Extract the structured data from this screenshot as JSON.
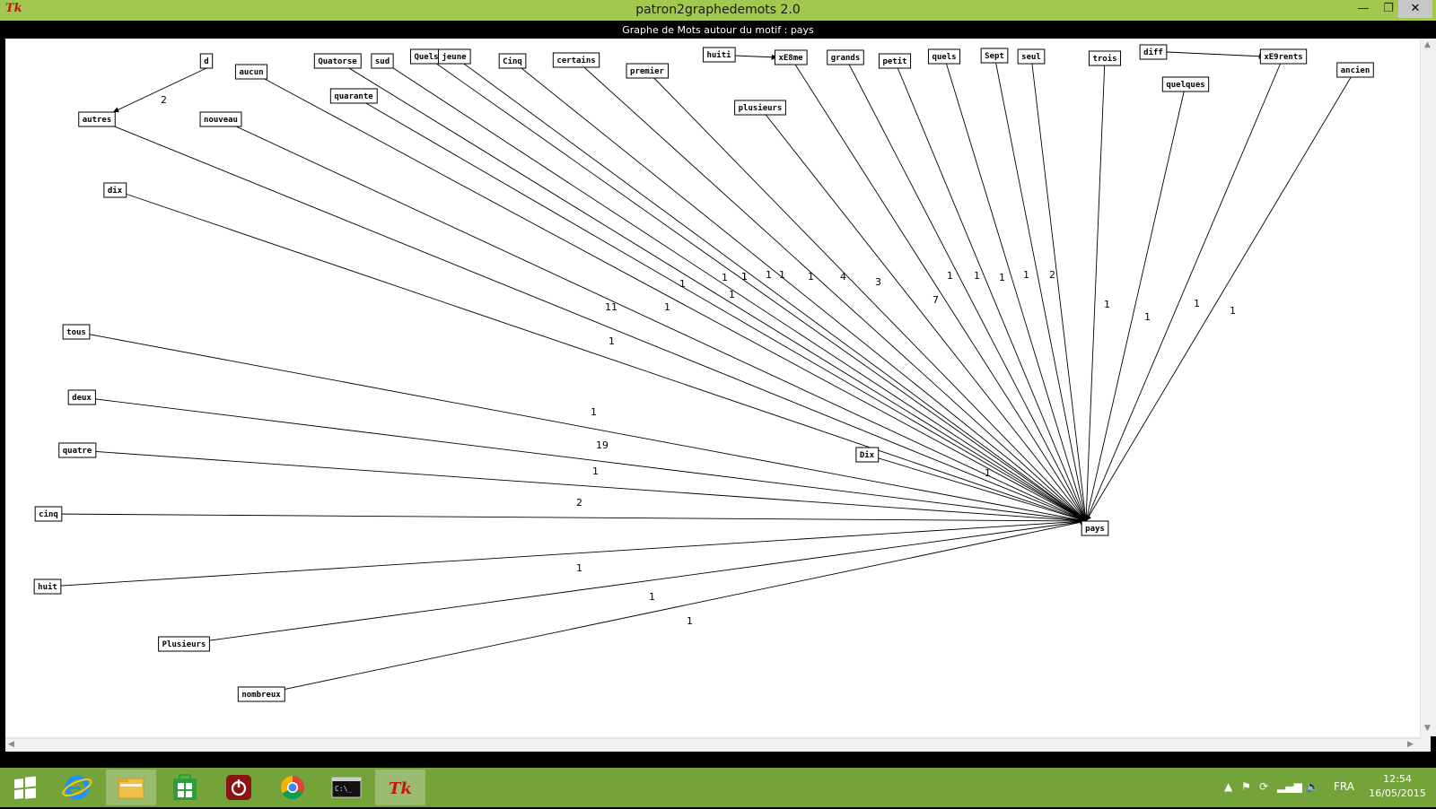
{
  "window": {
    "title": "patron2graphedemots 2.0",
    "app_icon": "Tk",
    "minimize": "—",
    "maximize": "❐",
    "close": "✕"
  },
  "graph": {
    "title": "Graphe de Mots autour du motif : pays",
    "target": "pays",
    "edges": [
      {
        "src": "autres",
        "label": "11"
      },
      {
        "src": "aucun",
        "label": "1"
      },
      {
        "src": "nouveau",
        "label": "1"
      },
      {
        "src": "dix",
        "label": "1"
      },
      {
        "src": "Quatorse",
        "label": "1"
      },
      {
        "src": "quarante",
        "label": "1"
      },
      {
        "src": "sud",
        "label": "1"
      },
      {
        "src": "Quels",
        "label": "1"
      },
      {
        "src": "jeune",
        "label": "1"
      },
      {
        "src": "Cinq",
        "label": "1"
      },
      {
        "src": "certains",
        "label": "4"
      },
      {
        "src": "premier",
        "label": "3"
      },
      {
        "src": "xE8me",
        "label": "7"
      },
      {
        "src": "plusieurs",
        "label": "1"
      },
      {
        "src": "grands",
        "label": "1"
      },
      {
        "src": "petit",
        "label": "1"
      },
      {
        "src": "quels",
        "label": "1"
      },
      {
        "src": "Sept",
        "label": "1"
      },
      {
        "src": "seul",
        "label": "2"
      },
      {
        "src": "trois",
        "label": "1"
      },
      {
        "src": "quelques",
        "label": "1"
      },
      {
        "src": "xE9rents",
        "label": "1"
      },
      {
        "src": "ancien",
        "label": "1"
      },
      {
        "src": "tous",
        "label": "1"
      },
      {
        "src": "deux",
        "label": "19"
      },
      {
        "src": "quatre",
        "label": "1"
      },
      {
        "src": "cinq",
        "label": "2"
      },
      {
        "src": "huit",
        "label": "1"
      },
      {
        "src": "Plusieurs",
        "label": "1"
      },
      {
        "src": "nombreux",
        "label": "1"
      },
      {
        "src": "Dix",
        "label": "1"
      }
    ],
    "side_edges": [
      {
        "src": "d",
        "dst": "autres",
        "label": "2"
      },
      {
        "src": "huiti",
        "dst": "xE8me",
        "label": ""
      },
      {
        "src": "diff",
        "dst": "xE9rents",
        "label": ""
      }
    ]
  },
  "taskbar": {
    "icons": [
      "windows-start-icon",
      "internet-explorer-icon",
      "file-explorer-icon",
      "store-icon",
      "power-app-icon",
      "chrome-icon",
      "command-prompt-icon",
      "tk-app-icon"
    ],
    "language": "FRA",
    "time": "12:54",
    "date": "16/05/2015"
  }
}
